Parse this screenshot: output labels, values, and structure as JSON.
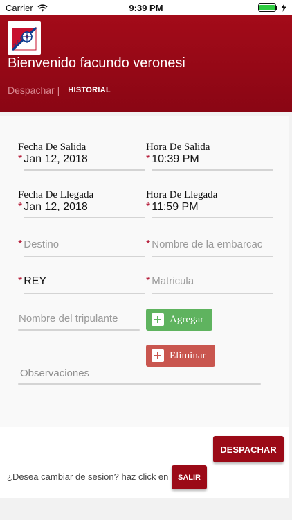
{
  "status_bar": {
    "carrier": "Carrier",
    "time": "9:39 PM"
  },
  "header": {
    "logo_text": "Y C F",
    "welcome": "Bienvenido facundo veronesi",
    "tab_despachar": "Despachar |",
    "tab_historial": "HISTORIAL"
  },
  "form": {
    "required_mark": "*",
    "fecha_salida": {
      "label": "Fecha De Salida",
      "value": "Jan 12, 2018"
    },
    "hora_salida": {
      "label": "Hora De Salida",
      "value": "10:39 PM"
    },
    "fecha_llegada": {
      "label": "Fecha De Llegada",
      "value": "Jan 12, 2018"
    },
    "hora_llegada": {
      "label": "Hora De Llegada",
      "value": "11:59 PM"
    },
    "destino": {
      "placeholder": "Destino"
    },
    "embarcacion": {
      "placeholder": "Nombre de la embarcac"
    },
    "rey": {
      "value": "REY"
    },
    "matricula": {
      "placeholder": "Matricula"
    },
    "tripulante": {
      "placeholder": "Nombre del tripulante"
    },
    "agregar_label": "Agregar",
    "eliminar_label": "Eliminar",
    "observaciones": {
      "placeholder": "Observaciones"
    }
  },
  "footer": {
    "despachar_label": "DESPACHAR",
    "change_session_text": "¿Desea cambiar de sesion? haz click en",
    "salir_label": "SALIR"
  },
  "colors": {
    "brand_red": "#9b0a17",
    "agregar_green": "#5fb35f",
    "eliminar_red": "#c9564f",
    "required": "#b2102f"
  },
  "icons": [
    "wifi-icon",
    "battery-icon",
    "charging-bolt-icon",
    "club-logo",
    "plus-icon"
  ]
}
